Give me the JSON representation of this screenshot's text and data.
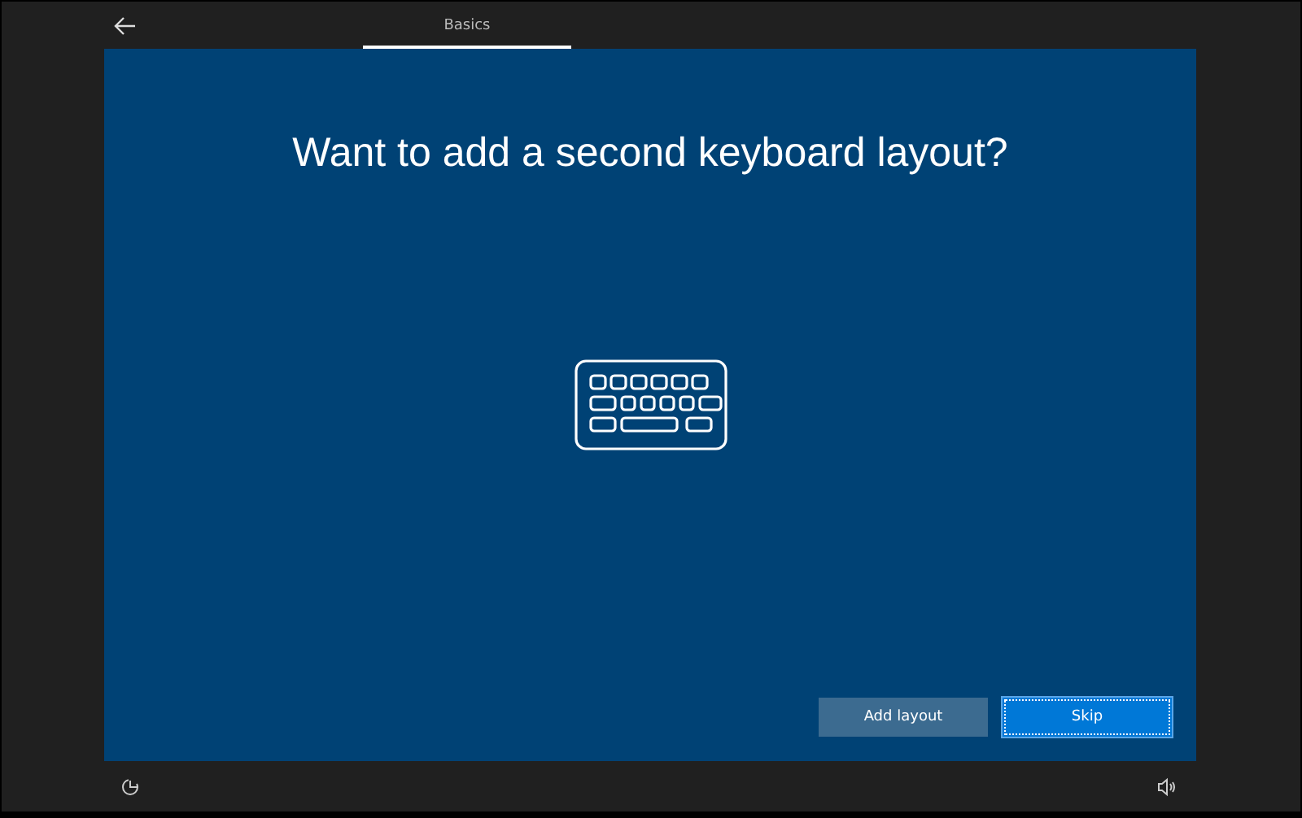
{
  "tabs": [
    {
      "label": "Basics",
      "selected": true
    }
  ],
  "title": "Want to add a second keyboard layout?",
  "buttons": [
    {
      "label": "Add layout",
      "kind": "secondary",
      "focused": false
    },
    {
      "label": "Skip",
      "kind": "primary",
      "focused": true
    }
  ]
}
